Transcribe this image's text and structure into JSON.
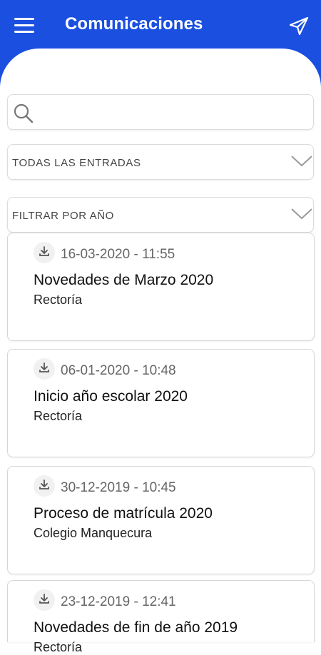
{
  "header": {
    "title": "Comunicaciones",
    "menu_icon": "hamburger-menu-icon",
    "send_icon": "send-icon",
    "color": "#1a4fe0"
  },
  "search": {
    "placeholder": "",
    "value": "",
    "icon": "search-icon"
  },
  "filters": {
    "entries_label": "TODAS LAS ENTRADAS",
    "year_label": "FILTRAR POR AÑO",
    "chevron_icon": "chevron-down-icon"
  },
  "communications": [
    {
      "date": "16-03-2020 - 11:55",
      "title": "Novedades de Marzo 2020",
      "author": "Rectoría"
    },
    {
      "date": "06-01-2020 - 10:48",
      "title": "Inicio año escolar 2020",
      "author": "Rectoría"
    },
    {
      "date": "30-12-2019 - 10:45",
      "title": "Proceso de matrícula 2020",
      "author": "Colegio Manquecura"
    },
    {
      "date": "23-12-2019 - 12:41",
      "title": "Novedades de fin de año 2019",
      "author": "Rectoría"
    }
  ]
}
